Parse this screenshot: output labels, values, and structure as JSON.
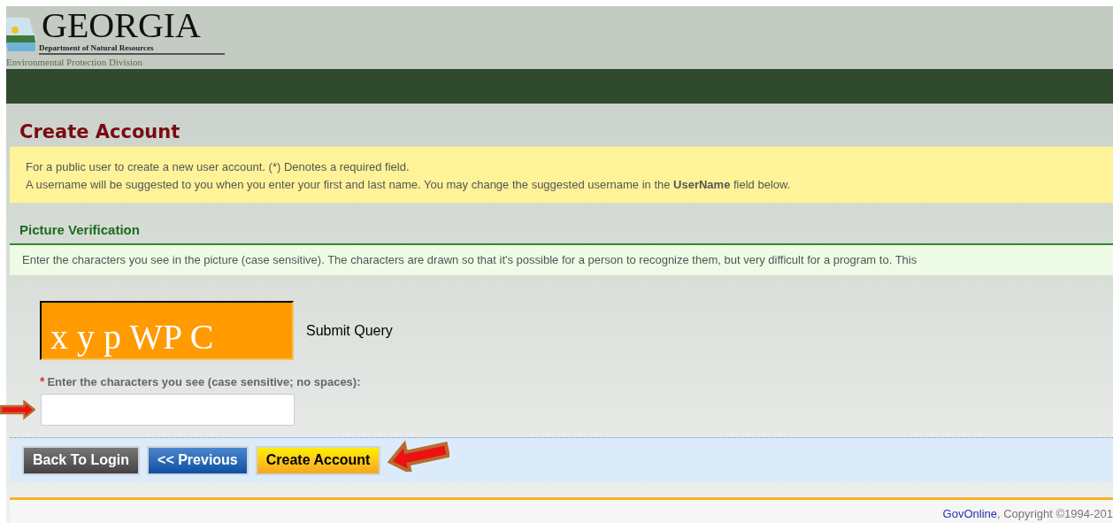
{
  "logo": {
    "title": "GEORGIA",
    "subtitle": "Department of Natural Resources",
    "division": "Environmental Protection Division"
  },
  "page_title": "Create Account",
  "notice": {
    "lines": [
      "For a public user to create a new user account. (*) Denotes a required field.",
      "A username will be suggested to you when you enter your first and last name. You may change the suggested username in the **UserName** field below."
    ]
  },
  "section": {
    "title": "Picture Verification",
    "instructions": "Enter the characters you see in the picture (case sensitive). The characters are drawn so that it's possible for a person to recognize them, but very difficult for a program to. This"
  },
  "captcha": {
    "text": "x y p WP C",
    "submit_label": "Submit Query"
  },
  "field": {
    "required_mark": "*",
    "label": "Enter the characters you see (case sensitive; no spaces):"
  },
  "buttons": [
    {
      "label": "Back To Login",
      "kind": "dark"
    },
    {
      "label": "<< Previous",
      "kind": "blue"
    },
    {
      "label": "Create Account",
      "kind": "yellow"
    }
  ],
  "footer": {
    "link": "GovOnline",
    "text": ", Copyright ©1994-201"
  }
}
